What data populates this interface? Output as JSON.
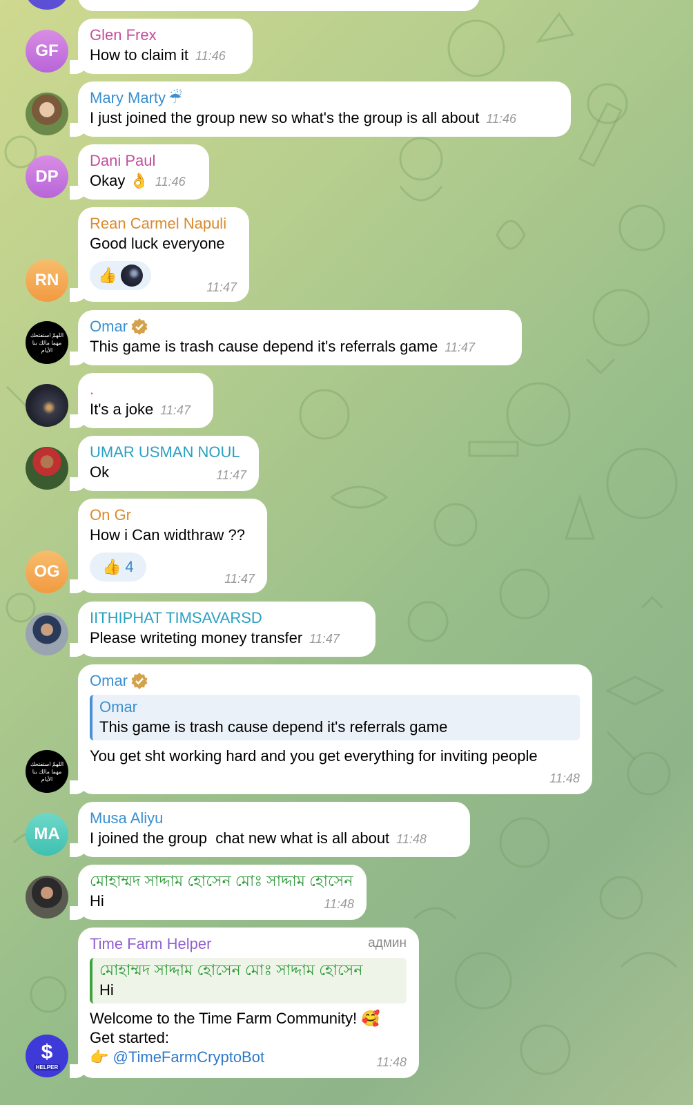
{
  "messages": [
    {
      "name": "Glen Frex",
      "initials": "GF",
      "text": "How to claim it",
      "time": "11:46"
    },
    {
      "name": "Mary Marty",
      "name_emoji": "☔",
      "text": "I just joined the group new so what's the group is all about",
      "time": "11:46"
    },
    {
      "name": "Dani Paul",
      "initials": "DP",
      "text": "Okay",
      "text_emoji": "👌",
      "time": "11:46"
    },
    {
      "name": "Rean Carmel Napuli",
      "initials": "RN",
      "text": "Good luck everyone",
      "reaction_emoji": "👍",
      "time": "11:47"
    },
    {
      "name": "Omar",
      "avatar_text": "اللهمّ استفتحك مهما مالك بنا الأيام",
      "text": "This game is trash cause depend it's referrals game",
      "time": "11:47"
    },
    {
      "name": ".",
      "text": "It's a joke",
      "time": "11:47"
    },
    {
      "name": "UMAR USMAN NOUL",
      "text": "Ok",
      "time": "11:47"
    },
    {
      "name": "On Gr",
      "initials": "OG",
      "text": "How i Can widthraw ??",
      "reaction_emoji": "👍",
      "reaction_count": "4",
      "time": "11:47"
    },
    {
      "name": "IITHIPHAT TIMSAVARSD",
      "text": "Please writeting money transfer",
      "time": "11:47"
    },
    {
      "name": "Omar",
      "quote_name": "Omar",
      "quote_text": "This game is trash cause depend it's referrals game",
      "text": "You get sht working hard and you get everything for inviting people",
      "time": "11:48"
    },
    {
      "name": "Musa Aliyu",
      "initials": "MA",
      "text": "I joined the group  chat new what is all about",
      "time": "11:48"
    },
    {
      "name": "মোহাম্মদ সাদ্দাম হোসেন মোঃ সাদ্দাম হোসেন",
      "text": "Hi",
      "time": "11:48"
    },
    {
      "name": "Time Farm Helper",
      "role": "админ",
      "quote_name": "মোহাম্মদ সাদ্দাম হোসেন মোঃ সাদ্দাম হোসেন",
      "quote_text": "Hi",
      "text": "Welcome to the Time Farm Community!",
      "text_emoji": "🥰",
      "line2": "Get started:",
      "link_emoji": "👉",
      "link": "@TimeFarmCryptoBot",
      "avatar_label": "HELPER",
      "time": "11:48"
    }
  ],
  "colors": {
    "glen": "#c3509a",
    "mary": "#3a8fd0",
    "dani": "#c3509a",
    "rean": "#d98a2e",
    "omar": "#3a8fd0",
    "dot": "#e0532f",
    "umar": "#2aa0c2",
    "ongr": "#d98a2e",
    "iith": "#2aa0c2",
    "musa": "#3a8fd0",
    "bengali": "#2e9a3a",
    "helper": "#9060d0",
    "link": "#2f7ac9",
    "time": "#9a9a9a"
  }
}
